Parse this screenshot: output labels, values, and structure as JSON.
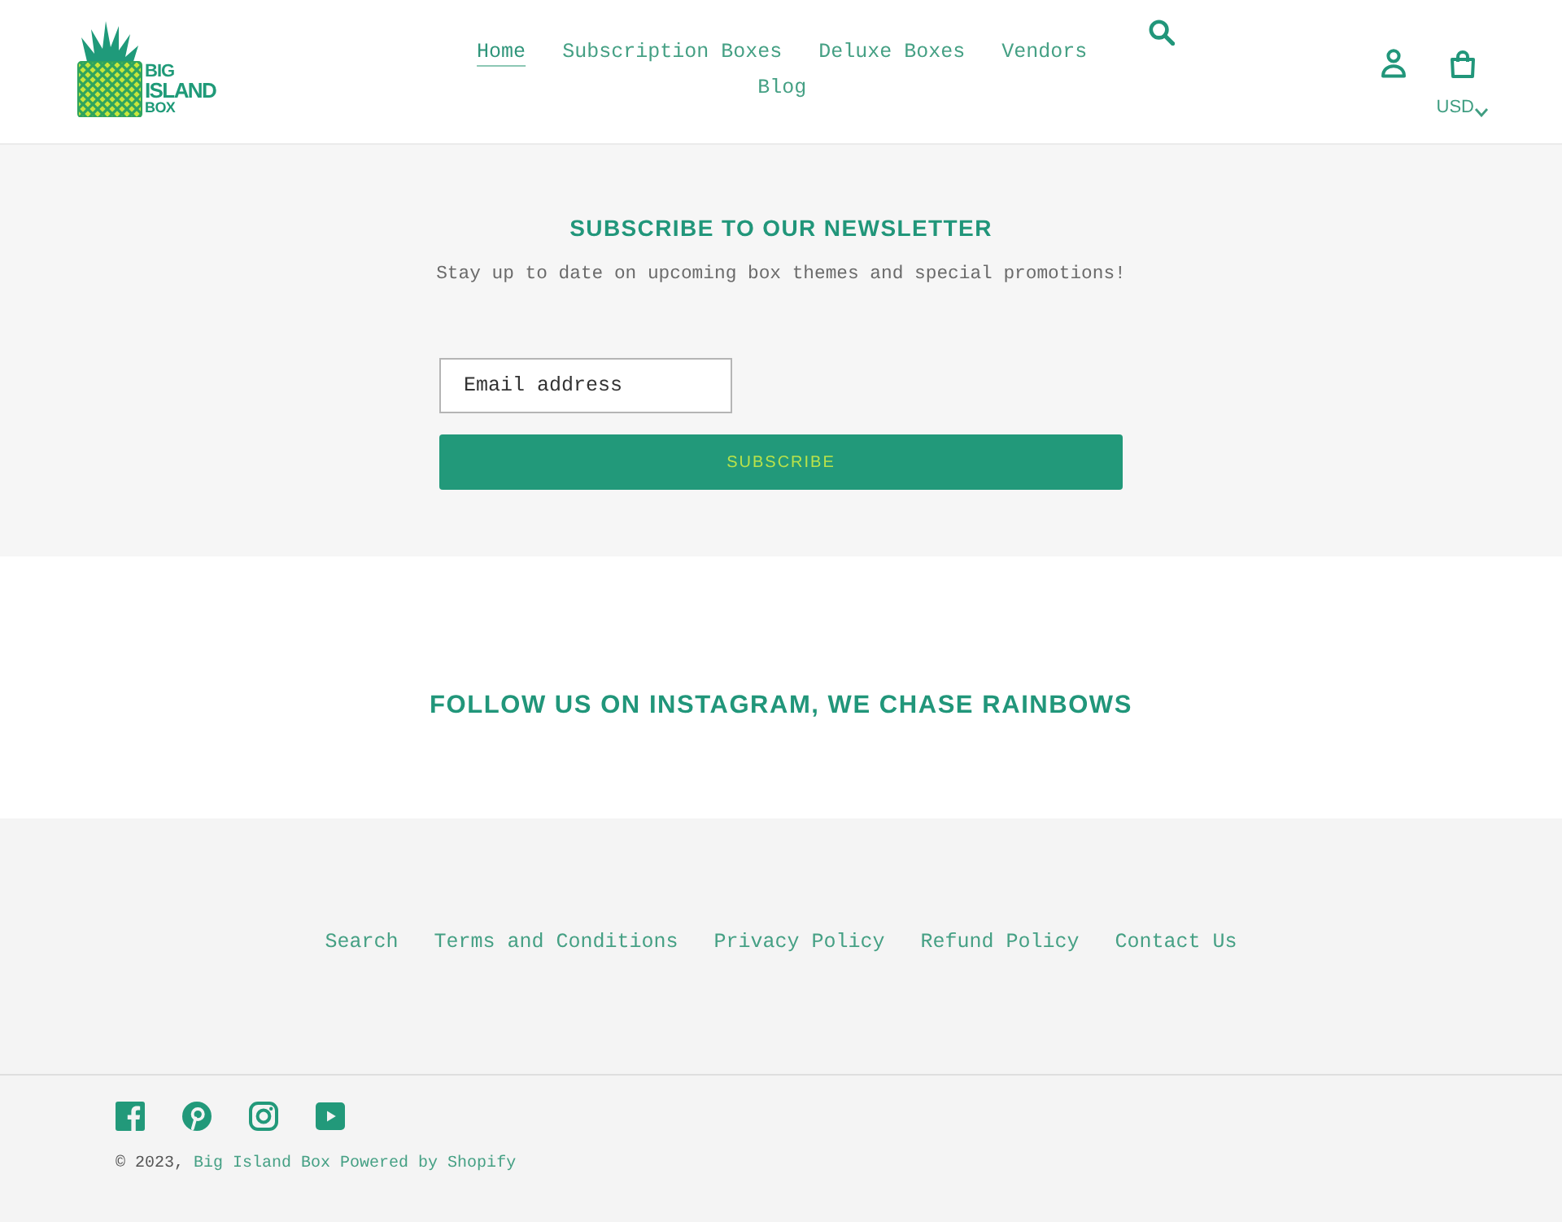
{
  "header": {
    "logo": {
      "lines": [
        "BIG",
        "ISLAND",
        "BOX"
      ]
    },
    "nav": [
      {
        "label": "Home",
        "selected": true
      },
      {
        "label": "Subscription Boxes",
        "selected": false
      },
      {
        "label": "Deluxe Boxes",
        "selected": false
      },
      {
        "label": "Vendors",
        "selected": false
      },
      {
        "label": "Blog",
        "selected": false
      }
    ],
    "currency": "USD"
  },
  "newsletter": {
    "title": "SUBSCRIBE TO OUR NEWSLETTER",
    "subtitle": "Stay up to date on upcoming box themes and special promotions!",
    "email": {
      "placeholder": "Email address"
    },
    "button": "SUBSCRIBE"
  },
  "instagram": {
    "title": "FOLLOW US ON INSTAGRAM, WE CHASE RAINBOWS"
  },
  "footer": {
    "links": [
      "Search",
      "Terms and Conditions",
      "Privacy Policy",
      "Refund Policy",
      "Contact Us"
    ],
    "copyright": {
      "prefix": "© 2023,",
      "store_link": "Big Island Box",
      "powered_by": "Powered by Shopify"
    }
  }
}
